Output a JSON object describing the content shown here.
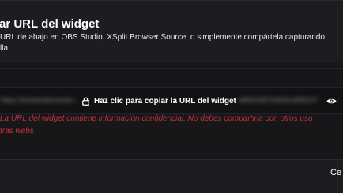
{
  "dialog": {
    "title": "ar URL del widget",
    "description_lines": [
      "URL de abajo en OBS Studio, XSplit Browser Source, o simplemente compártela capturando",
      "lla"
    ]
  },
  "url_field": {
    "blurred_left": "https://streamelements.com/overlay/widget",
    "copy_label": "Haz clic para copiar la URL del widget",
    "blurred_right": "a8f3c92b7e6d41a5f0c27e1b9a3d",
    "lock_icon": "lock-icon",
    "eye_icon": "eye-icon"
  },
  "warning": {
    "lines": [
      "La URL del widget contiene información confidencial. No debes compartirla con otros usu",
      "tras webs"
    ],
    "color": "#c0313a"
  },
  "footer": {
    "close_label": "Ce"
  }
}
